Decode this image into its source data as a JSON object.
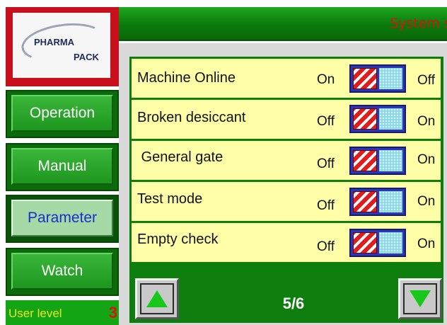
{
  "header": {
    "title": "System s"
  },
  "logo": {
    "line1": "PHARMA",
    "line2": "PACK"
  },
  "nav": {
    "items": [
      {
        "label": "Operation",
        "active": false
      },
      {
        "label": "Manual",
        "active": false
      },
      {
        "label": "Parameter",
        "active": true
      },
      {
        "label": "Watch",
        "active": false
      }
    ]
  },
  "user_level": {
    "label": "User level",
    "value": "3"
  },
  "params": [
    {
      "label": "Machine Online",
      "left_state": "On",
      "right_state": "Off"
    },
    {
      "label": "Broken desiccant",
      "left_state": "Off",
      "right_state": "On"
    },
    {
      "label": " General gate",
      "left_state": "Off",
      "right_state": "On"
    },
    {
      "label": "Test mode",
      "left_state": "Off",
      "right_state": "On"
    },
    {
      "label": "Empty check",
      "left_state": "Off",
      "right_state": "On"
    }
  ],
  "pager": {
    "page": "5/6",
    "up_icon": "triangle-up-icon",
    "down_icon": "triangle-down-icon"
  },
  "colors": {
    "title_text": "#e01010",
    "panel_green": "#0e7f0e",
    "row_yellow": "#ffffa8",
    "active_nav_text": "#1a2fd0",
    "user_level_text": "#e8e820",
    "user_level_value": "#e01010"
  }
}
